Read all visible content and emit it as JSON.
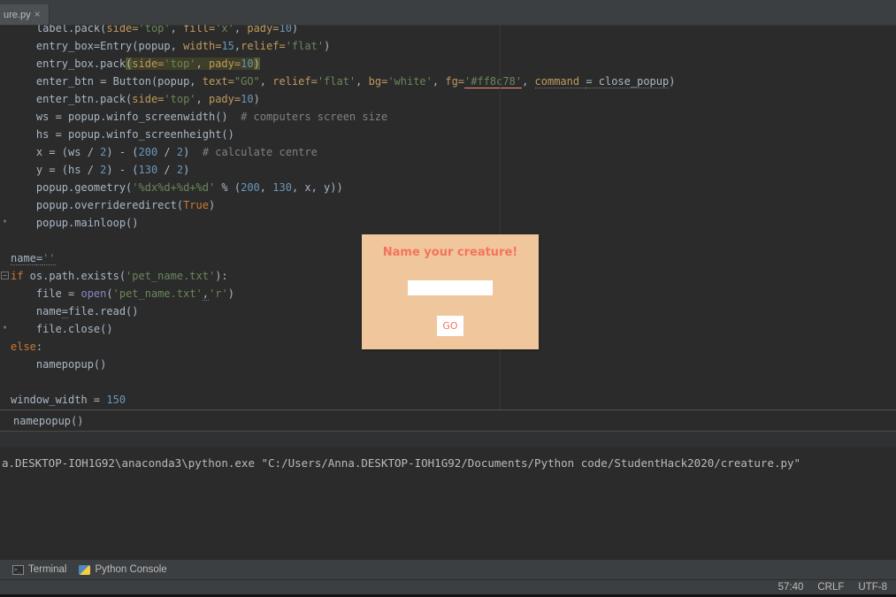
{
  "tab_bar": {
    "active_tab": "ure.py",
    "close": "×"
  },
  "editor": {
    "breadcrumb": "namepopup()",
    "lines": [
      {
        "tokens": [
          {
            "t": "    label.pack(",
            "c": "d"
          },
          {
            "t": "side=",
            "c": "a"
          },
          {
            "t": "'top'",
            "c": "s"
          },
          {
            "t": ", ",
            "c": "d"
          },
          {
            "t": "fill=",
            "c": "a"
          },
          {
            "t": "'x'",
            "c": "s"
          },
          {
            "t": ", ",
            "c": "d"
          },
          {
            "t": "pady=",
            "c": "a"
          },
          {
            "t": "10",
            "c": "n"
          },
          {
            "t": ")",
            "c": "d"
          }
        ]
      },
      {
        "tokens": [
          {
            "t": "    entry_box=Entry(popup, ",
            "c": "d"
          },
          {
            "t": "width=",
            "c": "a"
          },
          {
            "t": "15",
            "c": "n"
          },
          {
            "t": ",",
            "c": "d"
          },
          {
            "t": "relief=",
            "c": "a"
          },
          {
            "t": "'flat'",
            "c": "s"
          },
          {
            "t": ")",
            "c": "d"
          }
        ]
      },
      {
        "tokens": [
          {
            "t": "    entry_box.pack",
            "c": "d"
          },
          {
            "t": "(",
            "c": "d hp"
          },
          {
            "t": "side=",
            "c": "a h"
          },
          {
            "t": "'top'",
            "c": "s h"
          },
          {
            "t": ", ",
            "c": "d h"
          },
          {
            "t": "pady=",
            "c": "a h"
          },
          {
            "t": "10",
            "c": "n h"
          },
          {
            "t": ")",
            "c": "d hp"
          }
        ]
      },
      {
        "tokens": [
          {
            "t": "    enter_btn = Button(popup, ",
            "c": "d"
          },
          {
            "t": "text=",
            "c": "a"
          },
          {
            "t": "\"GO\"",
            "c": "s"
          },
          {
            "t": ", ",
            "c": "d"
          },
          {
            "t": "relief=",
            "c": "a"
          },
          {
            "t": "'flat'",
            "c": "s"
          },
          {
            "t": ", ",
            "c": "d"
          },
          {
            "t": "bg=",
            "c": "a"
          },
          {
            "t": "'white'",
            "c": "s"
          },
          {
            "t": ", ",
            "c": "d"
          },
          {
            "t": "fg=",
            "c": "a"
          },
          {
            "t": "'#ff8c78'",
            "c": "s uc"
          },
          {
            "t": ", ",
            "c": "d"
          },
          {
            "t": "command ",
            "c": "a uw"
          },
          {
            "t": "= close_popup",
            "c": "d uw"
          },
          {
            "t": ")",
            "c": "d"
          }
        ]
      },
      {
        "tokens": [
          {
            "t": "    enter_btn.pack(",
            "c": "d"
          },
          {
            "t": "side=",
            "c": "a"
          },
          {
            "t": "'top'",
            "c": "s"
          },
          {
            "t": ", ",
            "c": "d"
          },
          {
            "t": "pady=",
            "c": "a"
          },
          {
            "t": "10",
            "c": "n"
          },
          {
            "t": ")",
            "c": "d"
          }
        ]
      },
      {
        "tokens": [
          {
            "t": "    ws = popup.winfo_screenwidth()  ",
            "c": "d"
          },
          {
            "t": "# computers screen size",
            "c": "c"
          }
        ]
      },
      {
        "tokens": [
          {
            "t": "    hs = popup.winfo_screenheight()",
            "c": "d"
          }
        ]
      },
      {
        "tokens": [
          {
            "t": "    x = (ws / ",
            "c": "d"
          },
          {
            "t": "2",
            "c": "n"
          },
          {
            "t": ") - (",
            "c": "d"
          },
          {
            "t": "200",
            "c": "n"
          },
          {
            "t": " / ",
            "c": "d"
          },
          {
            "t": "2",
            "c": "n"
          },
          {
            "t": ")  ",
            "c": "d"
          },
          {
            "t": "# calculate centre",
            "c": "c"
          }
        ]
      },
      {
        "tokens": [
          {
            "t": "    y = (hs / ",
            "c": "d"
          },
          {
            "t": "2",
            "c": "n"
          },
          {
            "t": ") - (",
            "c": "d"
          },
          {
            "t": "130",
            "c": "n"
          },
          {
            "t": " / ",
            "c": "d"
          },
          {
            "t": "2",
            "c": "n"
          },
          {
            "t": ")",
            "c": "d"
          }
        ]
      },
      {
        "tokens": [
          {
            "t": "    popup.geometry(",
            "c": "d"
          },
          {
            "t": "'%dx%d+%d+%d'",
            "c": "s"
          },
          {
            "t": " % (",
            "c": "d"
          },
          {
            "t": "200",
            "c": "n"
          },
          {
            "t": ", ",
            "c": "d"
          },
          {
            "t": "130",
            "c": "n"
          },
          {
            "t": ", x, y))",
            "c": "d"
          }
        ]
      },
      {
        "tokens": [
          {
            "t": "    popup.overrideredirect(",
            "c": "d"
          },
          {
            "t": "True",
            "c": "k"
          },
          {
            "t": ")",
            "c": "d"
          }
        ]
      },
      {
        "fold": "arrow",
        "tokens": [
          {
            "t": "    popup.mainloop()",
            "c": "d"
          }
        ]
      },
      {
        "tokens": [
          {
            "t": " ",
            "c": "d"
          }
        ]
      },
      {
        "tokens": [
          {
            "t": "name",
            "c": "d uw"
          },
          {
            "t": "=",
            "c": "d uw"
          },
          {
            "t": "''",
            "c": "s uw"
          }
        ]
      },
      {
        "fold": "minus",
        "tokens": [
          {
            "t": "if",
            "c": "k"
          },
          {
            "t": " os.path.exists(",
            "c": "d"
          },
          {
            "t": "'pet_name.txt'",
            "c": "s"
          },
          {
            "t": "):",
            "c": "d"
          }
        ]
      },
      {
        "tokens": [
          {
            "t": "    file = ",
            "c": "d"
          },
          {
            "t": "open",
            "c": "b"
          },
          {
            "t": "(",
            "c": "d"
          },
          {
            "t": "'pet_name.txt'",
            "c": "s"
          },
          {
            "t": ",",
            "c": "d uw"
          },
          {
            "t": "'r'",
            "c": "s"
          },
          {
            "t": ")",
            "c": "d"
          }
        ]
      },
      {
        "tokens": [
          {
            "t": "    name",
            "c": "d"
          },
          {
            "t": "=",
            "c": "d uw"
          },
          {
            "t": "file.read()",
            "c": "d"
          }
        ]
      },
      {
        "fold": "arrow",
        "tokens": [
          {
            "t": "    file.close()",
            "c": "d"
          }
        ]
      },
      {
        "tokens": [
          {
            "t": "else",
            "c": "k"
          },
          {
            "t": ":",
            "c": "d"
          }
        ]
      },
      {
        "tokens": [
          {
            "t": "    namepopup()",
            "c": "d"
          }
        ]
      },
      {
        "tokens": [
          {
            "t": " ",
            "c": "d"
          }
        ]
      },
      {
        "tokens": [
          {
            "t": "window_width = ",
            "c": "d"
          },
          {
            "t": "150",
            "c": "n"
          }
        ]
      }
    ]
  },
  "popup": {
    "title": "Name your creature!",
    "entry_value": "",
    "go_label": "GO",
    "bg": "#f0c69c",
    "title_color": "#f4735e"
  },
  "run_console": {
    "command_line": "a.DESKTOP-IOH1G92\\anaconda3\\python.exe \"C:/Users/Anna.DESKTOP-IOH1G92/Documents/Python code/StudentHack2020/creature.py\""
  },
  "tool_window_bar": {
    "terminal_label": "Terminal",
    "python_console_label": "Python Console"
  },
  "status_bar": {
    "caret": "57:40",
    "line_sep": "CRLF",
    "encoding": "UTF-8"
  }
}
